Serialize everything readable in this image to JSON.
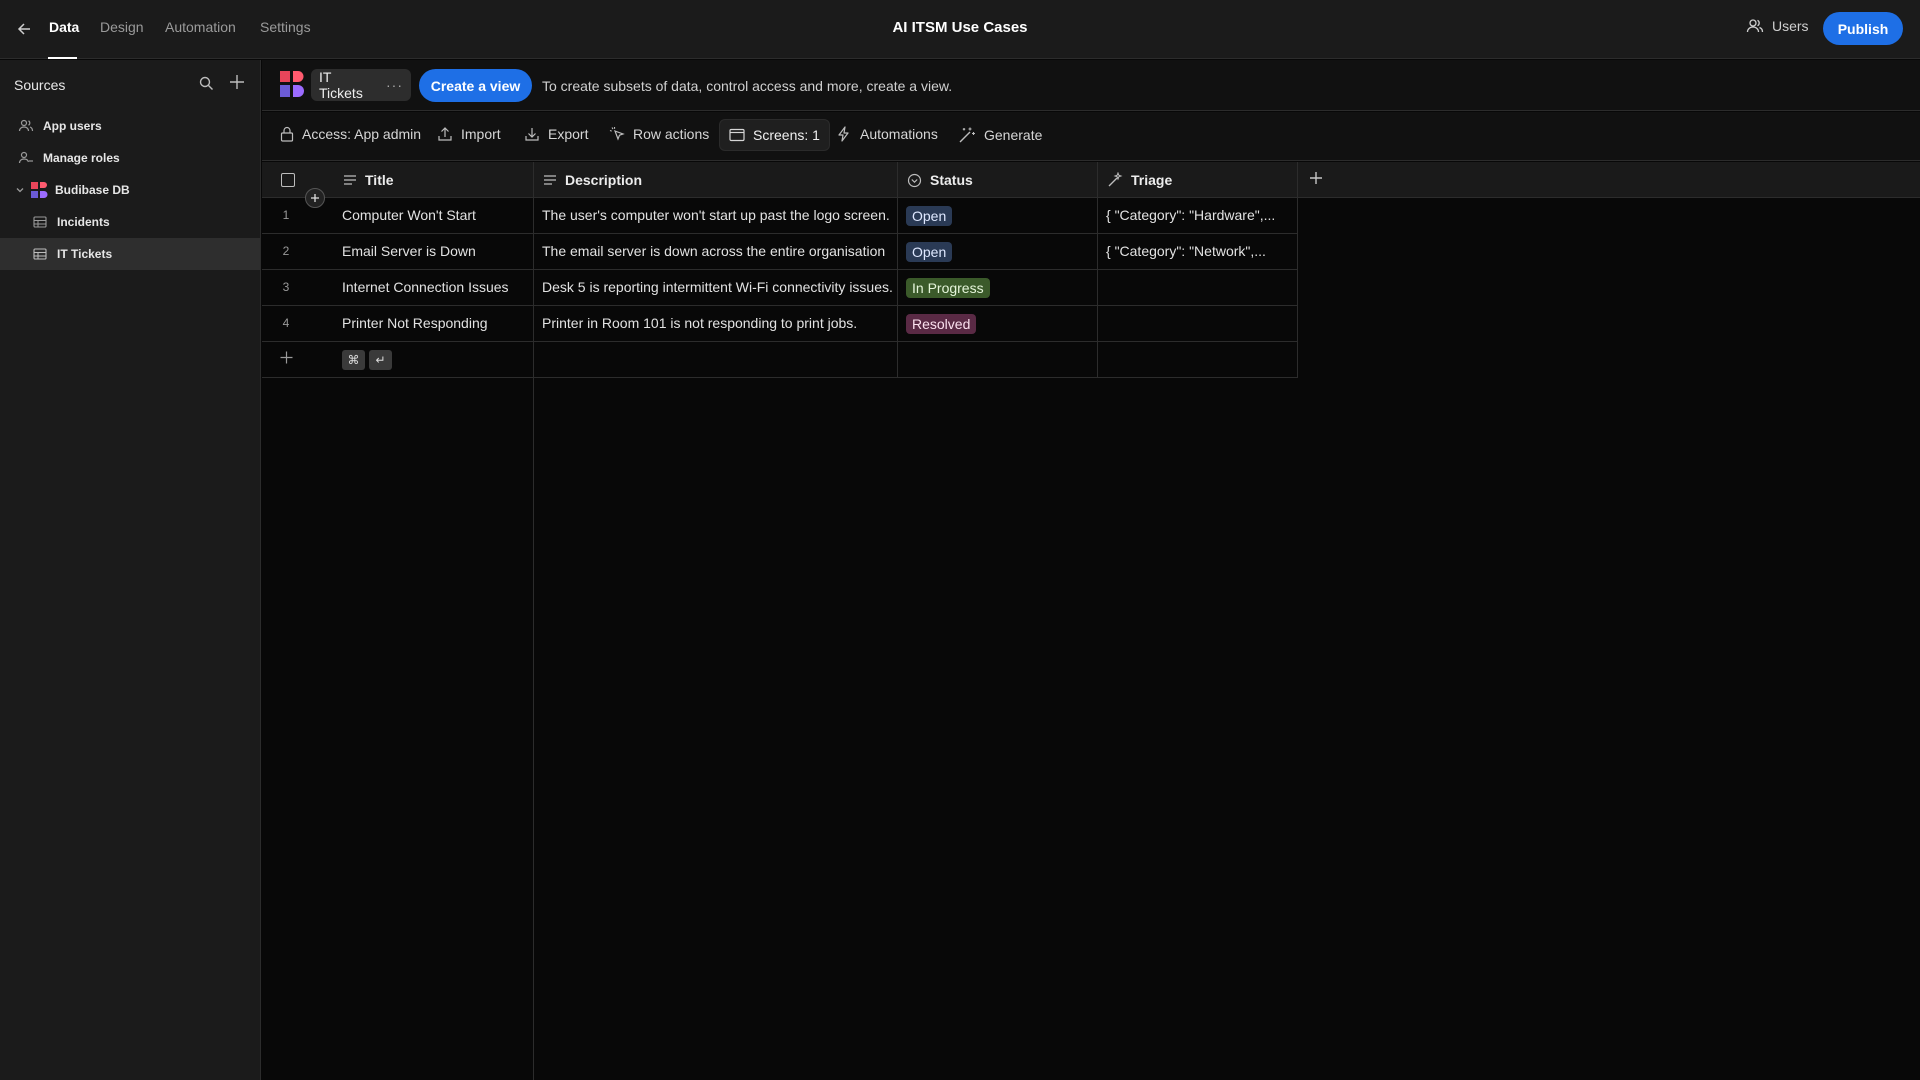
{
  "topbar": {
    "tabs": [
      {
        "label": "Data",
        "active": true
      },
      {
        "label": "Design",
        "active": false
      },
      {
        "label": "Automation",
        "active": false
      },
      {
        "label": "Settings",
        "active": false
      }
    ],
    "app_title": "AI ITSM Use Cases",
    "users_label": "Users",
    "publish_label": "Publish"
  },
  "sidebar": {
    "title": "Sources",
    "items": [
      {
        "label": "App users",
        "icon": "users-icon"
      },
      {
        "label": "Manage roles",
        "icon": "role-icon"
      },
      {
        "label": "Budibase DB",
        "icon": "budibase-logo",
        "expanded": true
      },
      {
        "label": "Incidents",
        "icon": "table-icon"
      },
      {
        "label": "IT Tickets",
        "icon": "table-icon",
        "selected": true
      }
    ]
  },
  "table_bar": {
    "table_name": "IT Tickets",
    "more_label": "···",
    "create_view_label": "Create a view",
    "hint": "To create subsets of data, control access and more, create a view."
  },
  "actions": {
    "access": "Access: App admin",
    "import": "Import",
    "export": "Export",
    "row_actions": "Row actions",
    "screens": "Screens: 1",
    "automations": "Automations",
    "generate": "Generate"
  },
  "grid": {
    "columns": [
      {
        "label": "Title",
        "icon": "text-icon"
      },
      {
        "label": "Description",
        "icon": "text-icon"
      },
      {
        "label": "Status",
        "icon": "options-icon"
      },
      {
        "label": "Triage",
        "icon": "ai-icon"
      }
    ],
    "rows": [
      {
        "num": "1",
        "title": "Computer Won't Start",
        "description": "The user's computer won't start up past the logo screen.",
        "status": "Open",
        "triage": "{ \"Category\": \"Hardware\",..."
      },
      {
        "num": "2",
        "title": "Email Server is Down",
        "description": "The email server is down across the entire organisation",
        "status": "Open",
        "triage": "{ \"Category\": \"Network\",..."
      },
      {
        "num": "3",
        "title": "Internet Connection Issues",
        "description": "Desk 5 is reporting intermittent Wi-Fi connectivity issues.",
        "status": "In Progress",
        "triage": ""
      },
      {
        "num": "4",
        "title": "Printer Not Responding",
        "description": "Printer in Room 101 is not responding to print jobs.",
        "status": "Resolved",
        "triage": ""
      }
    ],
    "shortcut_keys": [
      "⌘",
      "↵"
    ]
  },
  "colors": {
    "accent": "#1e6fe6",
    "status_open_bg": "#2a3a55",
    "status_inprogress_bg": "#3b5a2a",
    "status_resolved_bg": "#5a2a45"
  }
}
